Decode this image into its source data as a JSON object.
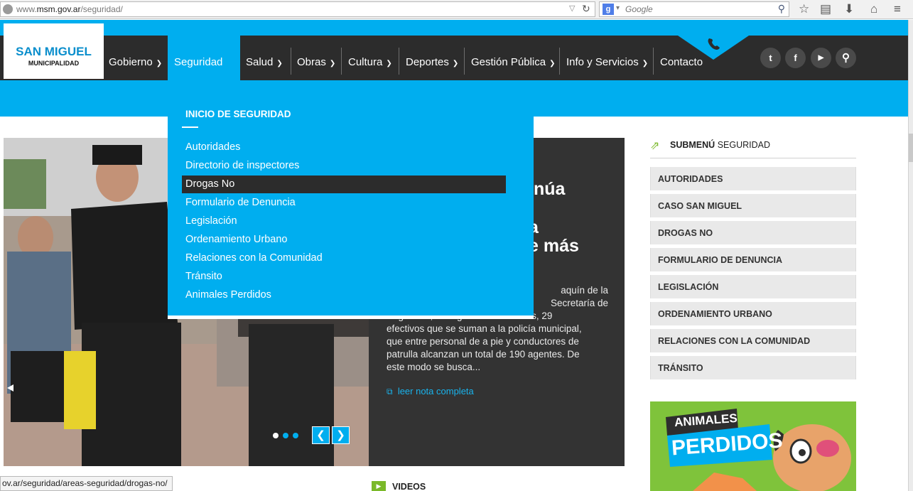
{
  "browser": {
    "url_prefix": "www.",
    "url_domain": "msm.gov.ar",
    "url_path": "/seguridad/",
    "search_engine_letter": "g",
    "search_placeholder": "Google",
    "status_url": "ov.ar/seguridad/areas-seguridad/drogas-no/"
  },
  "site": {
    "logo_line1": "SAN MIGUEL",
    "logo_line2": "MUNICIPALIDAD",
    "brand_color": "#00aeef",
    "nav_color": "#2c2c2c"
  },
  "nav": [
    {
      "label": "Gobierno",
      "has_menu": true
    },
    {
      "label": "Seguridad",
      "has_menu": false,
      "active": true
    },
    {
      "label": "Salud",
      "has_menu": true
    },
    {
      "label": "Obras",
      "has_menu": true
    },
    {
      "label": "Cultura",
      "has_menu": true
    },
    {
      "label": "Deportes",
      "has_menu": true
    },
    {
      "label": "Gestión Pública",
      "has_menu": true
    },
    {
      "label": "Info y Servicios",
      "has_menu": true
    },
    {
      "label": "Contacto",
      "has_menu": false
    }
  ],
  "social": [
    {
      "name": "twitter-icon",
      "glyph": "t"
    },
    {
      "name": "facebook-icon",
      "glyph": "f"
    },
    {
      "name": "youtube-icon",
      "glyph": "▶"
    },
    {
      "name": "search-icon",
      "glyph": "⚲"
    }
  ],
  "dropdown": {
    "title": "INICIO DE SEGURIDAD",
    "items": [
      "Autoridades",
      "Directorio de inspectores",
      "Drogas No",
      "Formulario de Denuncia",
      "Legislación",
      "Ordenamiento Urbano",
      "Relaciones con la Comunidad",
      "Tránsito",
      "Animales Perdidos"
    ],
    "highlighted_index": 2
  },
  "slider": {
    "headline_lines": [
      "inúa",
      "a",
      "e más"
    ],
    "body_lines": [
      "aquín de la",
      "Secretaría de",
      "Seguridad, a cargo de Max Perkins,  29",
      "efectivos que se suman a la policía municipal,",
      "que entre personal de a pie y conductores de",
      "patrulla alcanzan un total de 190 agentes. De",
      "este modo se busca..."
    ],
    "read_more": "leer nota completa",
    "slide_count": 3,
    "active_slide": 1
  },
  "submenu": {
    "title_bold": "SUBMENÚ",
    "title_rest": "SEGURIDAD",
    "items": [
      "AUTORIDADES",
      "CASO SAN MIGUEL",
      "DROGAS NO",
      "FORMULARIO DE DENUNCIA",
      "LEGISLACIÓN",
      "ORDENAMIENTO URBANO",
      "RELACIONES CON LA COMUNIDAD",
      "TRÁNSITO"
    ]
  },
  "banner": {
    "line1": "ANIMALES",
    "line2": "PERDIDOS"
  },
  "videos_label": "VIDEOS"
}
